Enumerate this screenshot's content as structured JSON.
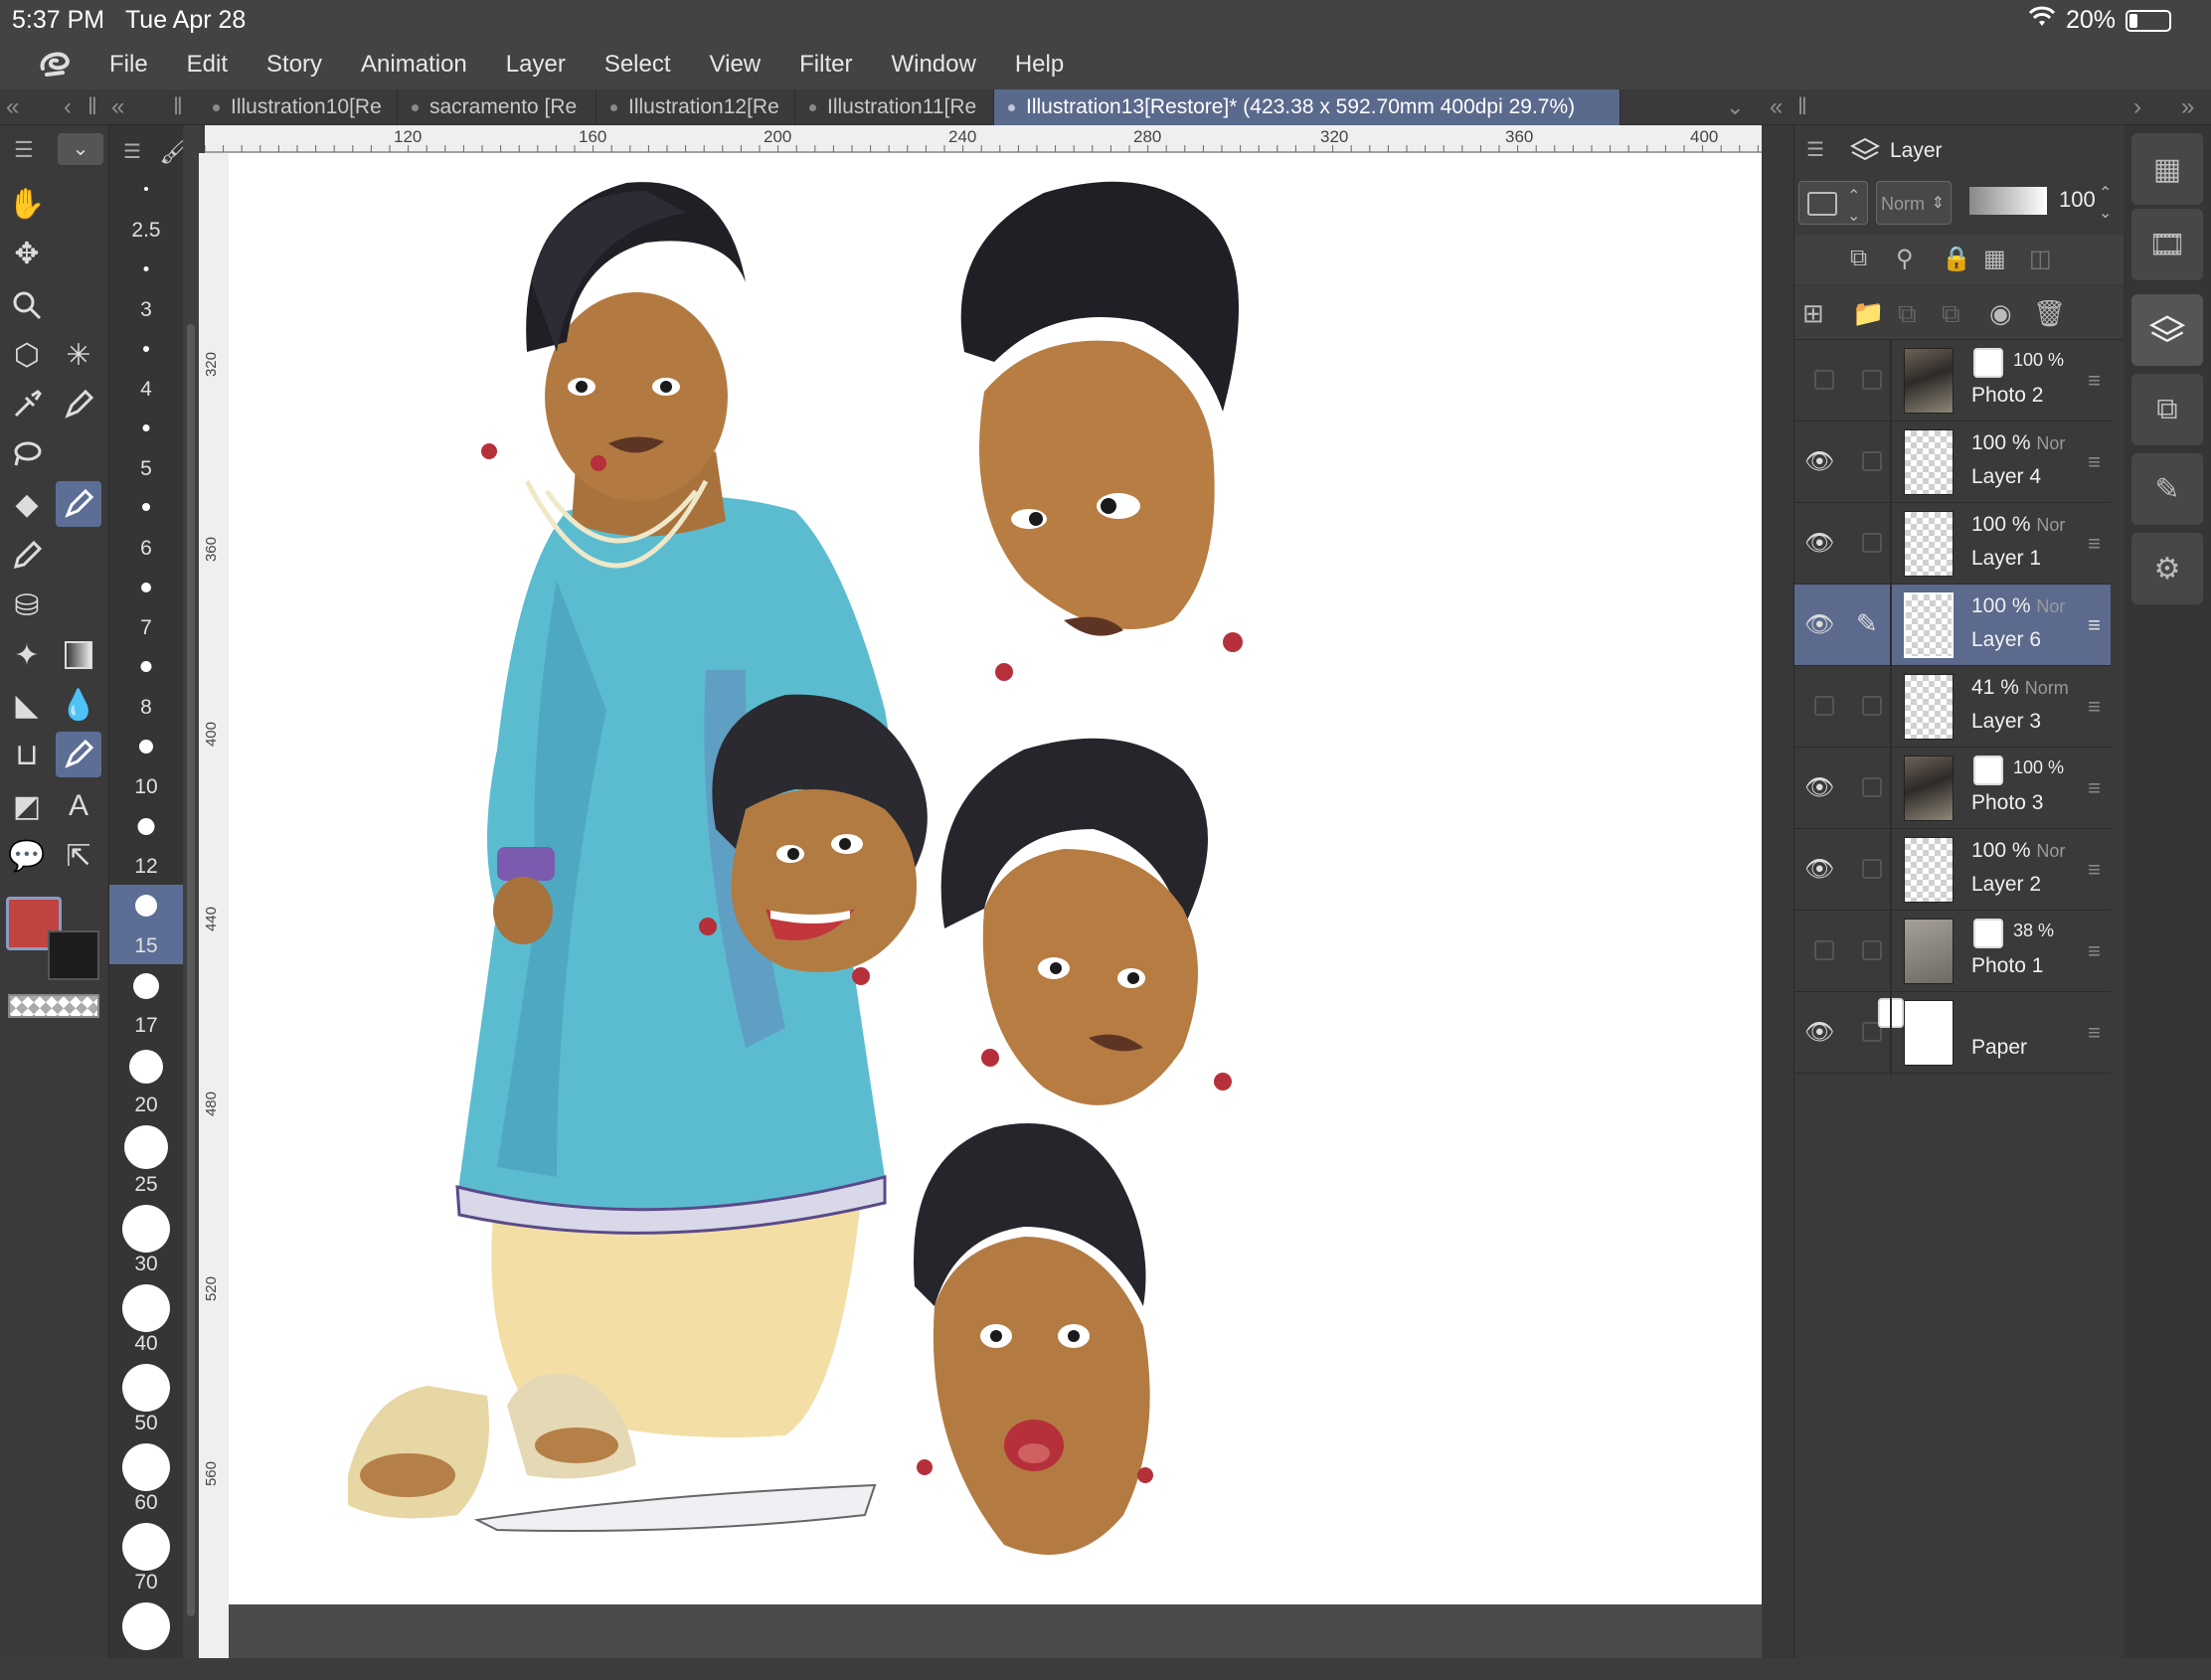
{
  "status_bar": {
    "time": "5:37 PM",
    "date": "Tue Apr 28",
    "battery": "20%"
  },
  "menu": [
    "File",
    "Edit",
    "Story",
    "Animation",
    "Layer",
    "Select",
    "View",
    "Filter",
    "Window",
    "Help"
  ],
  "tabs": [
    {
      "label": "Illustration10[Re"
    },
    {
      "label": "sacramento [Re"
    },
    {
      "label": "Illustration12[Re"
    },
    {
      "label": "Illustration11[Re"
    },
    {
      "label": "Illustration13[Restore]* (423.38 x 592.70mm 400dpi 29.7%)",
      "active": true
    }
  ],
  "brush_sizes": [
    "2.5",
    "3",
    "4",
    "5",
    "6",
    "7",
    "8",
    "10",
    "12",
    "15",
    "17",
    "20",
    "25",
    "30",
    "40",
    "50",
    "60",
    "70"
  ],
  "selected_brush_size": "15",
  "ruler_h": [
    "120",
    "160",
    "200",
    "240",
    "280",
    "320",
    "360",
    "400"
  ],
  "ruler_v": [
    "320",
    "360",
    "400",
    "440",
    "480",
    "520",
    "560"
  ],
  "colors": {
    "main": "#c0443f",
    "sub": "#1d1d1d",
    "accent": "#5c6e95"
  },
  "layer_panel": {
    "title": "Layer",
    "blend_mode": "Norm",
    "opacity": "100",
    "layers": [
      {
        "name": "Photo 2",
        "opacity": "100 %",
        "blend": "",
        "visible": false,
        "type": "photo",
        "mask": true
      },
      {
        "name": "Layer 4",
        "opacity": "100 %",
        "blend": "Nor",
        "visible": true,
        "type": "raster"
      },
      {
        "name": "Layer 1",
        "opacity": "100 %",
        "blend": "Nor",
        "visible": true,
        "type": "raster"
      },
      {
        "name": "Layer 6",
        "opacity": "100 %",
        "blend": "Nor",
        "visible": true,
        "type": "raster",
        "selected": true
      },
      {
        "name": "Layer 3",
        "opacity": "41 %",
        "blend": "Norm",
        "visible": false,
        "type": "raster"
      },
      {
        "name": "Photo 3",
        "opacity": "100 %",
        "blend": "",
        "visible": true,
        "type": "photo",
        "mask": true
      },
      {
        "name": "Layer 2",
        "opacity": "100 %",
        "blend": "Nor",
        "visible": true,
        "type": "raster"
      },
      {
        "name": "Photo 1",
        "opacity": "38 %",
        "blend": "",
        "visible": false,
        "type": "photo",
        "mask": true
      },
      {
        "name": "Paper",
        "opacity": "",
        "blend": "",
        "visible": true,
        "type": "paper",
        "mask": true
      }
    ]
  }
}
